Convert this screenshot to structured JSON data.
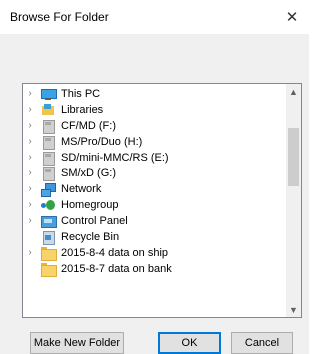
{
  "window": {
    "title": "Browse For Folder",
    "close_symbol": "✕"
  },
  "tree": {
    "items": [
      {
        "label": "This PC",
        "expandable": true,
        "icon": "computer-icon"
      },
      {
        "label": "Libraries",
        "expandable": true,
        "icon": "libraries-icon"
      },
      {
        "label": "CF/MD (F:)",
        "expandable": true,
        "icon": "removable-drive-icon"
      },
      {
        "label": "MS/Pro/Duo (H:)",
        "expandable": true,
        "icon": "removable-drive-icon"
      },
      {
        "label": "SD/mini-MMC/RS (E:)",
        "expandable": true,
        "icon": "removable-drive-icon"
      },
      {
        "label": "SM/xD (G:)",
        "expandable": true,
        "icon": "removable-drive-icon"
      },
      {
        "label": "Network",
        "expandable": true,
        "icon": "network-icon"
      },
      {
        "label": "Homegroup",
        "expandable": true,
        "icon": "homegroup-icon"
      },
      {
        "label": "Control Panel",
        "expandable": true,
        "icon": "control-panel-icon"
      },
      {
        "label": "Recycle Bin",
        "expandable": false,
        "icon": "recycle-bin-icon"
      },
      {
        "label": "2015-8-4 data on ship",
        "expandable": true,
        "icon": "folder-icon"
      },
      {
        "label": "2015-8-7 data on bank",
        "expandable": false,
        "icon": "folder-icon"
      }
    ],
    "chevron": "›",
    "scroll_up": "▲",
    "scroll_down": "▼"
  },
  "buttons": {
    "make_new_folder": "Make New Folder",
    "ok": "OK",
    "cancel": "Cancel"
  }
}
